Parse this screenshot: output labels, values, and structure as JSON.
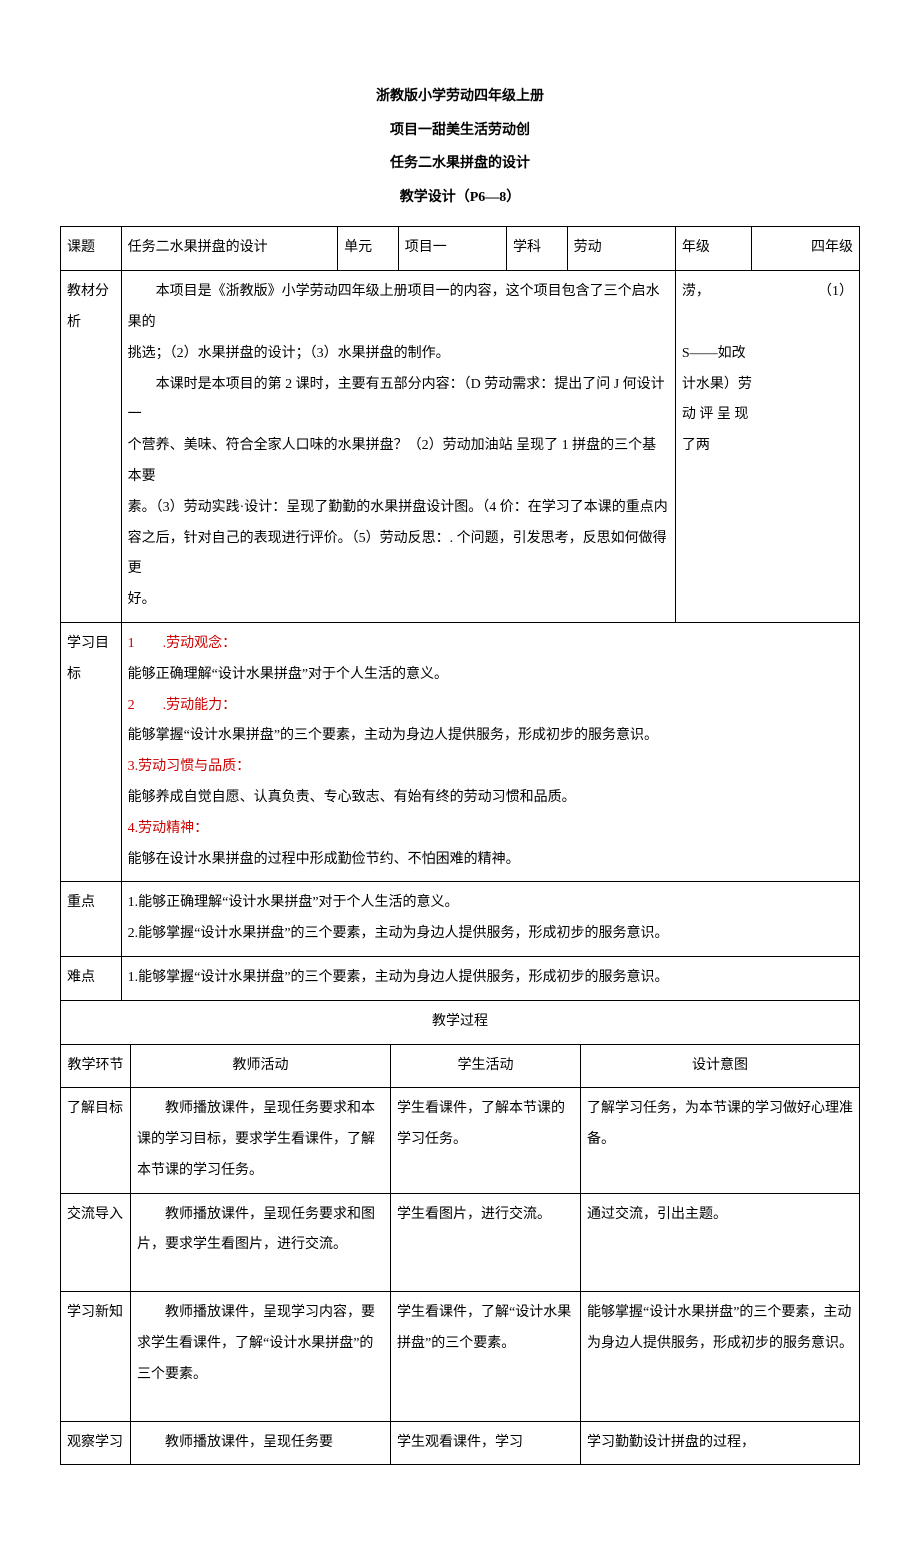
{
  "header": {
    "line1": "浙教版小学劳动四年级上册",
    "line2": "项目一甜美生活劳动创",
    "line3": "任务二水果拼盘的设计",
    "line4": "教学设计（P6—8）"
  },
  "meta": {
    "topic_label": "课题",
    "topic_value": "任务二水果拼盘的设计",
    "unit_label": "单元",
    "unit_value": "项目一",
    "subject_label": "学科",
    "subject_value": "劳动",
    "grade_label": "年级",
    "grade_value": "四年级"
  },
  "analysis": {
    "label": "教材分析",
    "p1a": "本项目是《浙教版》小学劳动四年级上册项目一的内容，这个项目包含了三个启水果的",
    "p1b": "涝，",
    "p1c": "（1）",
    "p2": "挑选；（2）水果拼盘的设计；（3）水果拼盘的制作。",
    "p3a": "本课时是本项目的第 2 课时，主要有五部分内容：（D 劳动需求：提出了问 J 何设计一",
    "p3b": "S——如改",
    "p4a": "个营养、美味、符合全家人口味的水果拼盘？（2）劳动加油站  呈现了 1 拼盘的三个基本要",
    "p4b": "计水果）劳",
    "p5a": "素。（3）劳动实践·设计：呈现了勤勤的水果拼盘设计图。（4 价：在学习了本课的重点内",
    "p5b": "动 评 呈 现",
    "p6a": "容之后，针对自己的表现进行评价。（5）劳动反思：. 个问题，引发思考，反思如何做得更",
    "p6b": "了两",
    "p7": "好。"
  },
  "goals": {
    "label": "学习目标",
    "g1_title": "1  .劳动观念：",
    "g1_text": "能够正确理解“设计水果拼盘”对于个人生活的意义。",
    "g2_title": "2  .劳动能力：",
    "g2_text": "能够掌握“设计水果拼盘”的三个要素，主动为身边人提供服务，形成初步的服务意识。",
    "g3_title": "3.劳动习惯与品质：",
    "g3_text": "能够养成自觉自愿、认真负责、专心致志、有始有终的劳动习惯和品质。",
    "g4_title": "4.劳动精神：",
    "g4_text": "能够在设计水果拼盘的过程中形成勤俭节约、不怕困难的精神。"
  },
  "keypoint": {
    "label": "重点",
    "l1": "1.能够正确理解“设计水果拼盘”对于个人生活的意义。",
    "l2": "2.能够掌握“设计水果拼盘”的三个要素，主动为身边人提供服务，形成初步的服务意识。"
  },
  "difficulty": {
    "label": "难点",
    "l1": "1.能够掌握“设计水果拼盘”的三个要素，主动为身边人提供服务，形成初步的服务意识。"
  },
  "process": {
    "title": "教学过程",
    "col_stage": "教学环节",
    "col_teacher": "教师活动",
    "col_student": "学生活动",
    "col_intent": "设计意图",
    "rows": [
      {
        "stage": "了解目标",
        "teacher": "　　教师播放课件，呈现任务要求和本课的学习目标，要求学生看课件，了解本节课的学习任务。",
        "student": "学生看课件，了解本节课的学习任务。",
        "intent": "了解学习任务，为本节课的学习做好心理准备。"
      },
      {
        "stage": "交流导入",
        "teacher": "　　教师播放课件，呈现任务要求和图片，要求学生看图片，进行交流。",
        "student": "学生看图片，进行交流。",
        "intent": "通过交流，引出主题。"
      },
      {
        "stage": "学习新知",
        "teacher": "　　教师播放课件，呈现学习内容，要求学生看课件，了解“设计水果拼盘”的三个要素。",
        "student": "学生看课件，了解“设计水果拼盘”的三个要素。",
        "intent": "能够掌握“设计水果拼盘”的三个要素，主动为身边人提供服务，形成初步的服务意识。"
      },
      {
        "stage": "观察学习",
        "teacher": "　　教师播放课件，呈现任务要",
        "student": "学生观看课件，学习",
        "intent": "学习勤勤设计拼盘的过程，"
      }
    ]
  }
}
